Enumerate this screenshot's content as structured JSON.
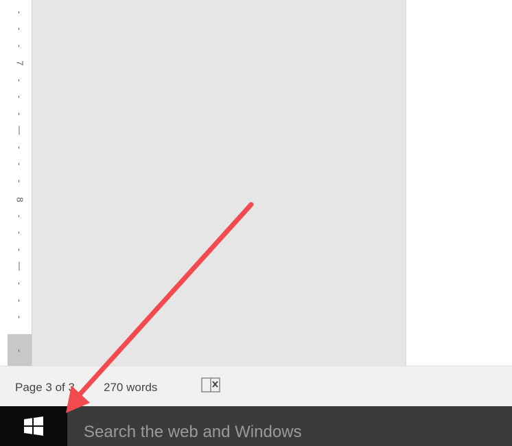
{
  "ruler": {
    "labels": [
      "7",
      "8"
    ]
  },
  "status_bar": {
    "page_count": "Page 3 of 3",
    "word_count": "270 words",
    "proofing_icon": "book-proofing-error-icon"
  },
  "taskbar": {
    "start_icon": "windows-logo-icon",
    "search_placeholder": "Search the web and Windows"
  },
  "annotation": {
    "arrow_color": "#f24a4f"
  },
  "colors": {
    "canvas": "#e6e6e6",
    "status_bar": "#f1f1f1",
    "taskbar": "#000000",
    "search_box": "#3b3b3b"
  }
}
